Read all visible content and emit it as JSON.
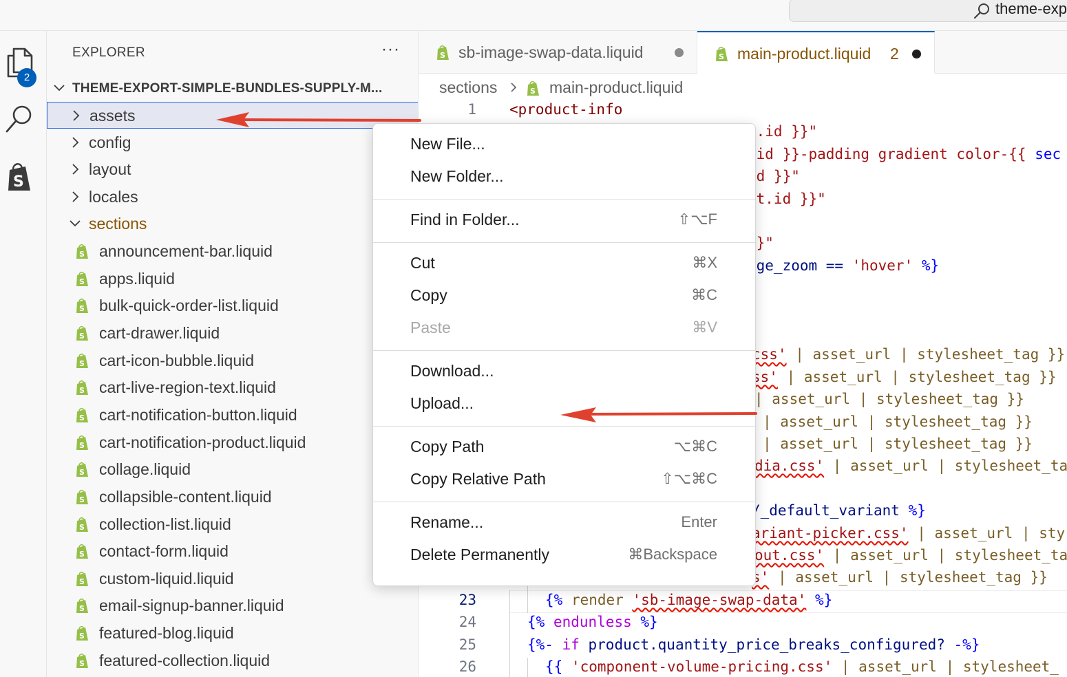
{
  "title_bar": {
    "search_label": "theme-exp"
  },
  "activity_bar": {
    "explorer_badge": "2"
  },
  "explorer": {
    "title": "EXPLORER",
    "more": "···",
    "root": "THEME-EXPORT-SIMPLE-BUNDLES-SUPPLY-M...",
    "folders": [
      {
        "label": "assets",
        "state": "collapsed",
        "selected": true
      },
      {
        "label": "config",
        "state": "collapsed"
      },
      {
        "label": "layout",
        "state": "collapsed"
      },
      {
        "label": "locales",
        "state": "collapsed"
      },
      {
        "label": "sections",
        "state": "expanded"
      }
    ],
    "files": [
      "announcement-bar.liquid",
      "apps.liquid",
      "bulk-quick-order-list.liquid",
      "cart-drawer.liquid",
      "cart-icon-bubble.liquid",
      "cart-live-region-text.liquid",
      "cart-notification-button.liquid",
      "cart-notification-product.liquid",
      "collage.liquid",
      "collapsible-content.liquid",
      "collection-list.liquid",
      "contact-form.liquid",
      "custom-liquid.liquid",
      "email-signup-banner.liquid",
      "featured-blog.liquid",
      "featured-collection.liquid"
    ]
  },
  "editor": {
    "tabs": [
      {
        "label": "sb-image-swap-data.liquid",
        "modified": true
      },
      {
        "label": "main-product.liquid",
        "problems": "2",
        "modified": true,
        "active": true
      }
    ],
    "breadcrumb": {
      "folder": "sections",
      "file": "main-product.liquid"
    },
    "line_numbers": {
      "first": "1",
      "l23": "23",
      "l24": "24",
      "l25": "25",
      "l26": "26"
    },
    "code_fragments": {
      "l1": "<product-info",
      "f2": "n.id }}\"",
      "f3a": ".id }}-padding gradient color-{{ ",
      "f3b": "sec",
      "f4": "id }}\"",
      "f5": "ct.id }}\"",
      "f7": "}}\"",
      "f8a": "age_zoom == ",
      "f8b": "'hover'",
      "f8c": " %}",
      "f12a": "css'",
      "f12b": " | asset_url | stylesheet_tag }}",
      "f13a": "ss'",
      "f13b": " | asset_url | stylesheet_tag }}",
      "f14": "| asset_url | stylesheet_tag }}",
      "f15": "| asset_url | stylesheet_tag }}",
      "f16": "| asset_url | stylesheet_tag }}",
      "f17a": "dia.css'",
      "f17b": " | asset_url | stylesheet_ta",
      "f19a": "/_default_variant",
      "f19b": " %}",
      "f20a": "ariant-picker.css'",
      "f20b": " | asset_url | sty",
      "f21a": "out.css'",
      "f21b": " | asset_url | stylesheet_ta",
      "f22a": "s'",
      "f22b": " | asset_url | stylesheet_tag }}",
      "l23a": "{%",
      "l23b": " render ",
      "l23c": "'sb-image-swap-data'",
      "l23d": " %}",
      "l24a": "{%",
      "l24b": " endunless ",
      "l24c": "%}",
      "l25a": "{%-",
      "l25b": " if ",
      "l25c": "product.quantity_price_breaks_configured?",
      "l25d": " -%}",
      "l26a": "{{",
      "l26b": " 'component-volume-pricing.css'",
      "l26c": " | asset_url | stylesheet_"
    }
  },
  "context_menu": {
    "groups": [
      [
        {
          "label": "New File...",
          "shortcut": ""
        },
        {
          "label": "New Folder...",
          "shortcut": ""
        }
      ],
      [
        {
          "label": "Find in Folder...",
          "shortcut": "⇧⌥F"
        }
      ],
      [
        {
          "label": "Cut",
          "shortcut": "⌘X"
        },
        {
          "label": "Copy",
          "shortcut": "⌘C"
        },
        {
          "label": "Paste",
          "shortcut": "⌘V",
          "disabled": true
        }
      ],
      [
        {
          "label": "Download...",
          "shortcut": ""
        },
        {
          "label": "Upload...",
          "shortcut": ""
        }
      ],
      [
        {
          "label": "Copy Path",
          "shortcut": "⌥⌘C"
        },
        {
          "label": "Copy Relative Path",
          "shortcut": "⇧⌥⌘C"
        }
      ],
      [
        {
          "label": "Rename...",
          "shortcut": "Enter"
        },
        {
          "label": "Delete Permanently",
          "shortcut": "⌘Backspace"
        }
      ]
    ]
  },
  "colors": {
    "accent": "#005fb8",
    "modified_folder": "#895503",
    "shopify_green": "#95bf47",
    "annotation_arrow": "#e0412e"
  }
}
